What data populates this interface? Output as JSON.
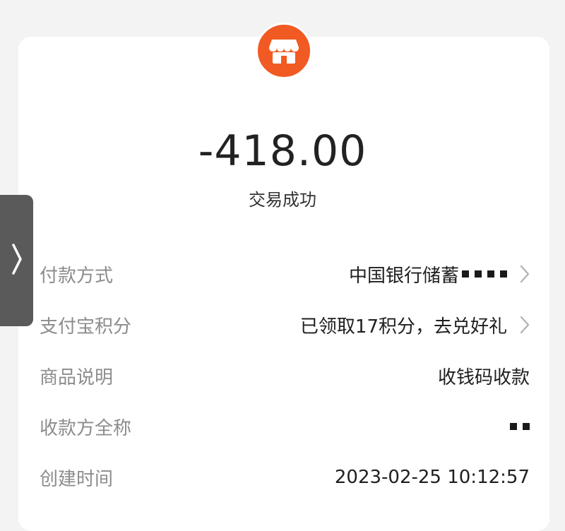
{
  "icons": {
    "merchant": "storefront-icon",
    "chevron": "chevron-right-icon",
    "side_handle": "chevron-right-icon"
  },
  "colors": {
    "merchant_icon_bg": "#f15a22",
    "amount_text": "#222222",
    "label_text": "#8c8c8c",
    "value_text": "#1f1f1f",
    "side_tab_bg": "#5a5a5a"
  },
  "transaction": {
    "amount": "-418.00",
    "status": "交易成功"
  },
  "details": {
    "payment_method": {
      "label": "付款方式",
      "value": "中国银行储蓄"
    },
    "points": {
      "label": "支付宝积分",
      "value": "已领取17积分，去兑好礼"
    },
    "product_desc": {
      "label": "商品说明",
      "value": "收钱码收款"
    },
    "payee": {
      "label": "收款方全称"
    },
    "created_time": {
      "label": "创建时间",
      "value": "2023-02-25 10:12:57"
    }
  }
}
